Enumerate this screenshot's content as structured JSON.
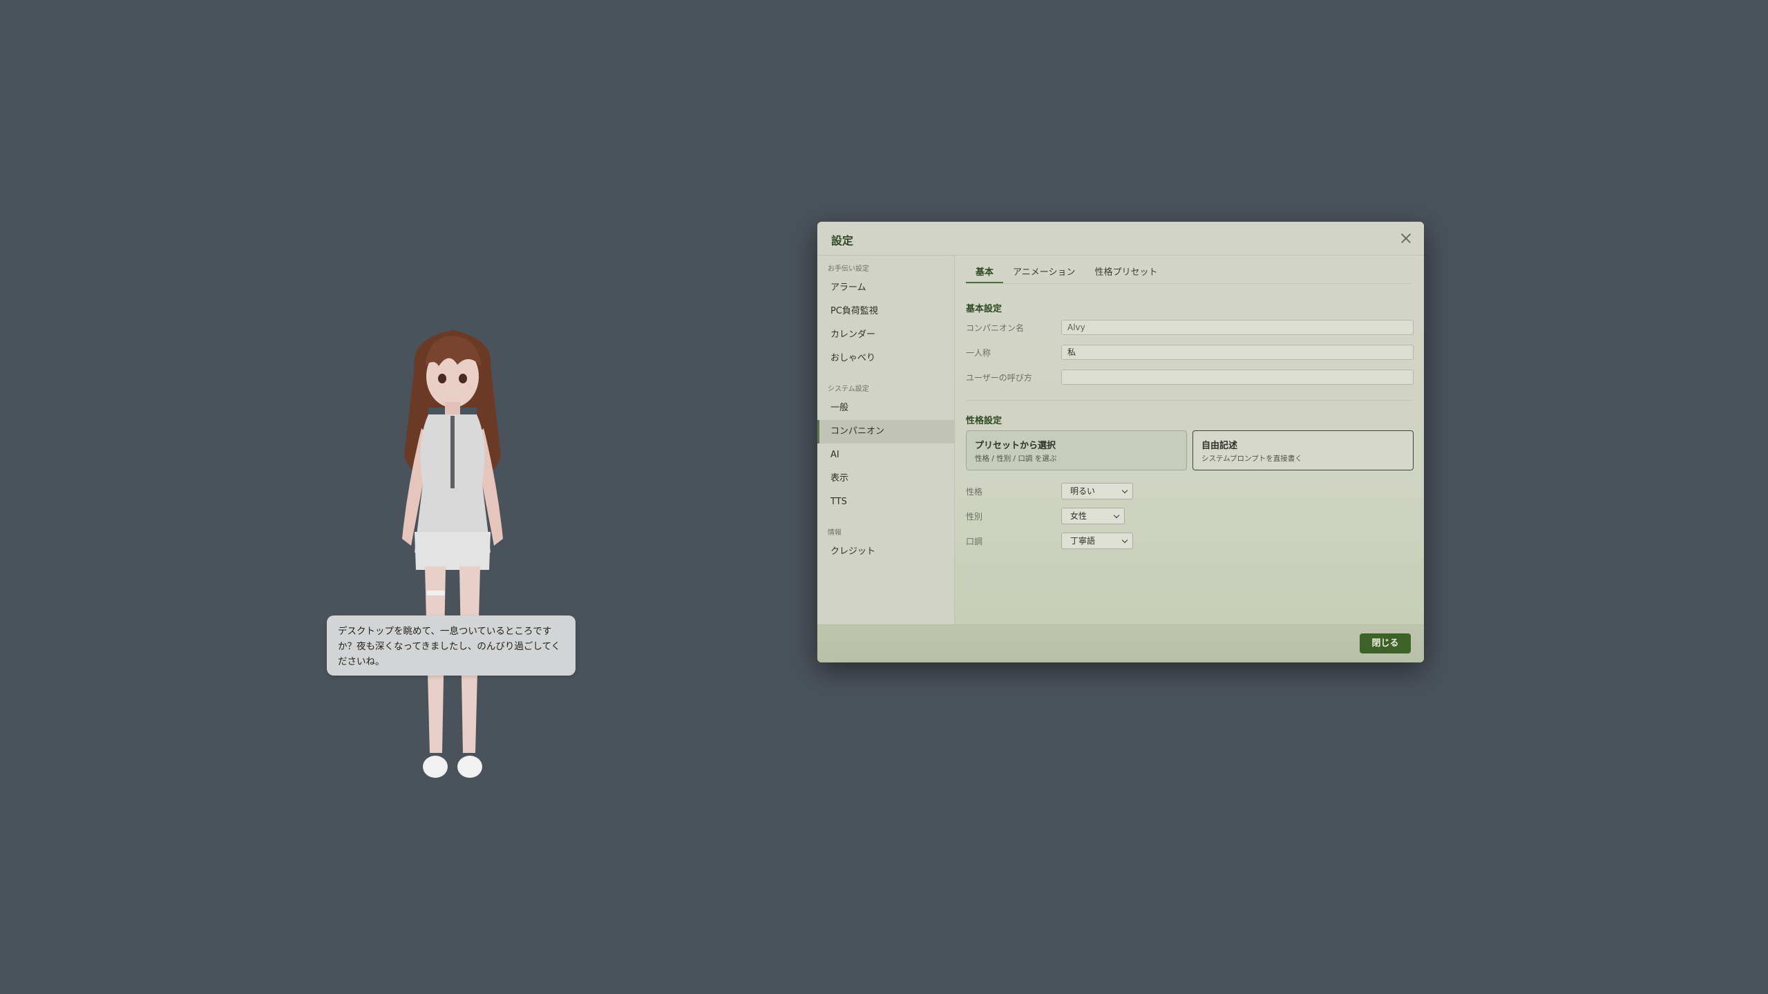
{
  "speech": {
    "text": "デスクトップを眺めて、一息ついているところですか？夜も深くなってきましたし、のんびり過ごしてくださいね。"
  },
  "dialog": {
    "title": "設定",
    "close_icon": "close-icon"
  },
  "sidebar": {
    "sections": [
      {
        "label": "お手伝い設定",
        "items": [
          "アラーム",
          "PC負荷監視",
          "カレンダー",
          "おしゃべり"
        ]
      },
      {
        "label": "システム設定",
        "items": [
          "一般",
          "コンパニオン",
          "AI",
          "表示",
          "TTS"
        ]
      },
      {
        "label": "情報",
        "items": [
          "クレジット"
        ]
      }
    ],
    "active": "コンパニオン"
  },
  "tabs": {
    "items": [
      "基本",
      "アニメーション",
      "性格プリセット"
    ],
    "active": "基本"
  },
  "basic": {
    "title": "基本設定",
    "name_label": "コンパニオン名",
    "name_placeholder": "Alvy",
    "first_person_label": "一人称",
    "first_person_value": "私",
    "user_call_label": "ユーザーの呼び方",
    "user_call_value": ""
  },
  "personality": {
    "title": "性格設定",
    "preset_card": {
      "title": "プリセットから選択",
      "subtitle": "性格 / 性別 / 口調 を選ぶ"
    },
    "free_card": {
      "title": "自由記述",
      "subtitle": "システムプロンプトを直接書く"
    },
    "trait_label": "性格",
    "trait_value": "明るい",
    "gender_label": "性別",
    "gender_value": "女性",
    "tone_label": "口調",
    "tone_value": "丁寧語"
  },
  "footer": {
    "close_label": "閉じる"
  },
  "colors": {
    "desktop_bg": "#4a525b",
    "accent": "#3c6228",
    "dialog_bg": "#d3d4c9"
  }
}
